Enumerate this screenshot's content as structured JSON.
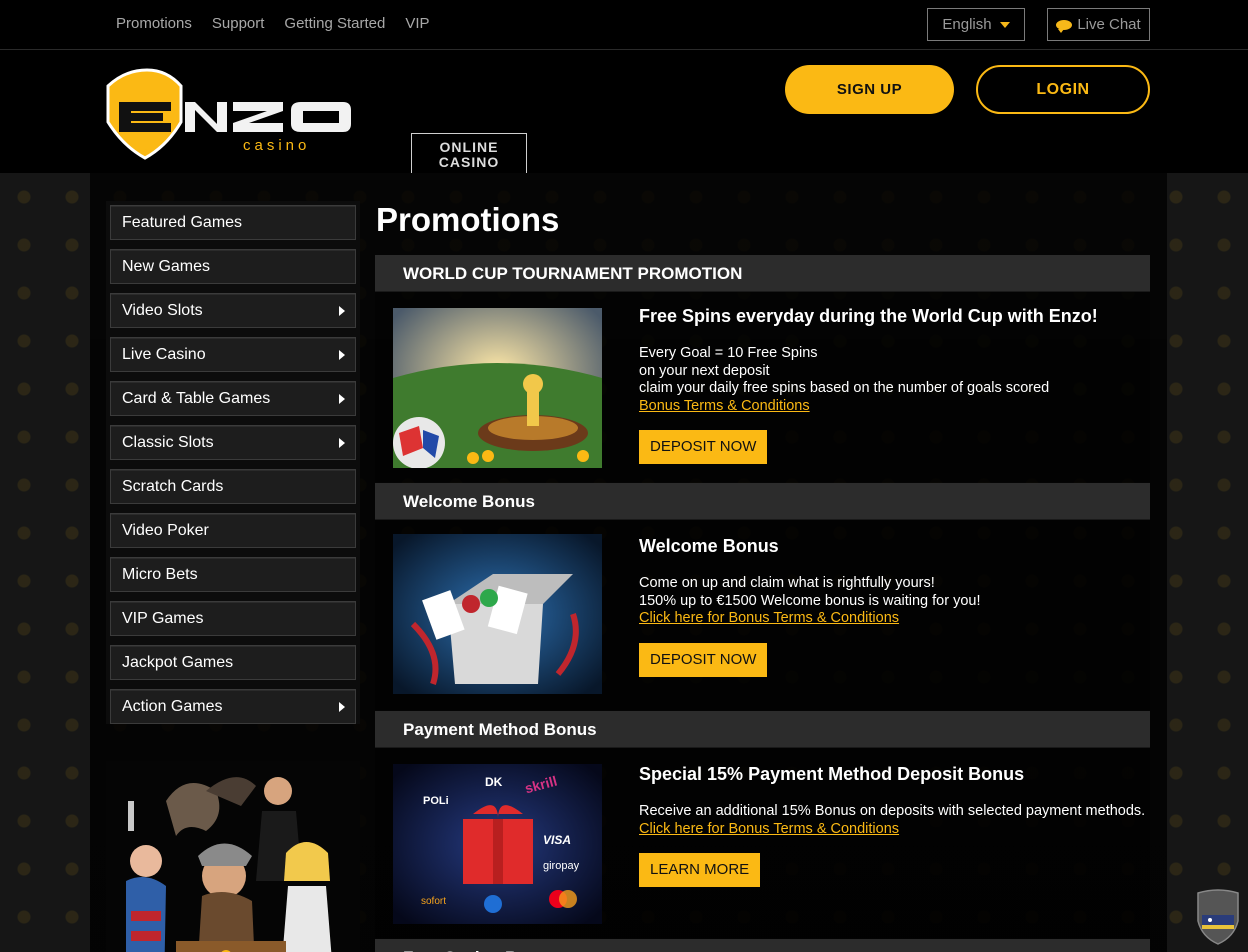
{
  "topnav": {
    "items": [
      "Promotions",
      "Support",
      "Getting Started",
      "VIP"
    ],
    "language": "English",
    "live_chat": "Live Chat"
  },
  "header": {
    "logo_main": "ENZO",
    "logo_sub": "casino",
    "signup": "SIGN UP",
    "login": "LOGIN",
    "tab_line1": "ONLINE",
    "tab_line2": "CASINO"
  },
  "sidebar": {
    "items": [
      {
        "label": "Featured Games",
        "arrow": false
      },
      {
        "label": "New Games",
        "arrow": false
      },
      {
        "label": "Video Slots",
        "arrow": true
      },
      {
        "label": "Live Casino",
        "arrow": true
      },
      {
        "label": "Card & Table Games",
        "arrow": true
      },
      {
        "label": "Classic Slots",
        "arrow": true
      },
      {
        "label": "Scratch Cards",
        "arrow": false
      },
      {
        "label": "Video Poker",
        "arrow": false
      },
      {
        "label": "Micro Bets",
        "arrow": false
      },
      {
        "label": "VIP Games",
        "arrow": false
      },
      {
        "label": "Jackpot Games",
        "arrow": false
      },
      {
        "label": "Action Games",
        "arrow": true
      }
    ]
  },
  "main": {
    "title": "Promotions",
    "sections": [
      {
        "heading": "WORLD CUP TOURNAMENT PROMOTION",
        "title": "Free Spins everyday during the World Cup with Enzo!",
        "lines": [
          "Every Goal = 10 Free Spins",
          "on your next deposit",
          "claim your daily free spins based on the number of goals scored"
        ],
        "link": "Bonus Terms & Conditions",
        "button": "DEPOSIT NOW"
      },
      {
        "heading": "Welcome Bonus",
        "title": "Welcome Bonus",
        "lines": [
          "Come on up and claim what is rightfully yours!",
          "150% up to €1500 Welcome bonus is waiting for you!"
        ],
        "link": "Click here for Bonus Terms & Conditions",
        "button": "DEPOSIT NOW"
      },
      {
        "heading": "Payment Method Bonus",
        "title": "Special 15% Payment Method Deposit Bonus",
        "lines": [
          "Receive an additional 15% Bonus on deposits with selected payment methods."
        ],
        "link": "Click here for Bonus Terms & Conditions",
        "button": "LEARN MORE"
      }
    ],
    "next_heading": "Free Casino Bonuses"
  },
  "payment_logos": [
    "DK",
    "skrill",
    "POLi",
    "VISA",
    "giropay",
    "sofort"
  ],
  "colors": {
    "accent": "#fbb914",
    "background": "#000000",
    "panel": "#2c2c2c"
  }
}
